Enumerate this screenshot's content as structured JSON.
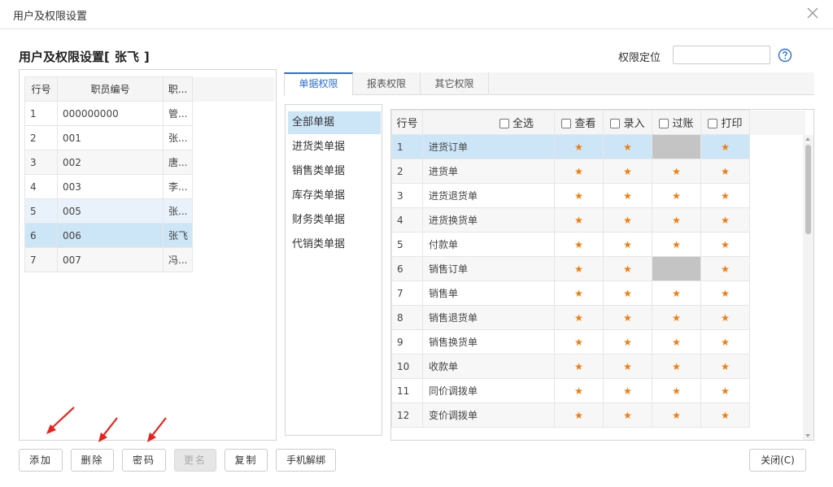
{
  "window": {
    "title": "用户及权限设置"
  },
  "header": {
    "prefix": "用户及权限设置[",
    "user_name": "张飞",
    "suffix": "]"
  },
  "search": {
    "label": "权限定位",
    "value": "",
    "placeholder": ""
  },
  "user_table": {
    "columns": [
      "行号",
      "职员编号",
      "职..."
    ],
    "rows": [
      {
        "idx": "1",
        "code": "000000000",
        "name": "管..."
      },
      {
        "idx": "2",
        "code": "001",
        "name": "张..."
      },
      {
        "idx": "3",
        "code": "002",
        "name": "唐..."
      },
      {
        "idx": "4",
        "code": "003",
        "name": "李..."
      },
      {
        "idx": "5",
        "code": "005",
        "name": "张..."
      },
      {
        "idx": "6",
        "code": "006",
        "name": "张飞"
      },
      {
        "idx": "7",
        "code": "007",
        "name": "冯..."
      }
    ]
  },
  "tabs": [
    {
      "label": "单据权限",
      "active": true
    },
    {
      "label": "报表权限",
      "active": false
    },
    {
      "label": "其它权限",
      "active": false
    }
  ],
  "categories": [
    {
      "label": "全部单据",
      "active": true
    },
    {
      "label": "进货类单据",
      "active": false
    },
    {
      "label": "销售类单据",
      "active": false
    },
    {
      "label": "库存类单据",
      "active": false
    },
    {
      "label": "财务类单据",
      "active": false
    },
    {
      "label": "代销类单据",
      "active": false
    }
  ],
  "perm_table": {
    "columns": {
      "idx": "行号",
      "select_all": "全选",
      "view": "查看",
      "entry": "录入",
      "post": "过账",
      "print": "打印"
    },
    "star": "★",
    "rows": [
      {
        "idx": "1",
        "doc": "进货订单",
        "view": true,
        "entry": true,
        "post": "disabled",
        "print": true
      },
      {
        "idx": "2",
        "doc": "进货单",
        "view": true,
        "entry": true,
        "post": true,
        "print": true
      },
      {
        "idx": "3",
        "doc": "进货退货单",
        "view": true,
        "entry": true,
        "post": true,
        "print": true
      },
      {
        "idx": "4",
        "doc": "进货换货单",
        "view": true,
        "entry": true,
        "post": true,
        "print": true
      },
      {
        "idx": "5",
        "doc": "付款单",
        "view": true,
        "entry": true,
        "post": true,
        "print": true
      },
      {
        "idx": "6",
        "doc": "销售订单",
        "view": true,
        "entry": true,
        "post": "disabled",
        "print": true
      },
      {
        "idx": "7",
        "doc": "销售单",
        "view": true,
        "entry": true,
        "post": true,
        "print": true
      },
      {
        "idx": "8",
        "doc": "销售退货单",
        "view": true,
        "entry": true,
        "post": true,
        "print": true
      },
      {
        "idx": "9",
        "doc": "销售换货单",
        "view": true,
        "entry": true,
        "post": true,
        "print": true
      },
      {
        "idx": "10",
        "doc": "收款单",
        "view": true,
        "entry": true,
        "post": true,
        "print": true
      },
      {
        "idx": "11",
        "doc": "同价调拨单",
        "view": true,
        "entry": true,
        "post": true,
        "print": true
      },
      {
        "idx": "12",
        "doc": "变价调拨单",
        "view": true,
        "entry": true,
        "post": true,
        "print": true
      }
    ]
  },
  "buttons": {
    "add": "添加",
    "delete": "删除",
    "password": "密码",
    "rename": "更名",
    "copy": "复制",
    "unbind": "手机解绑",
    "close": "关闭(C)"
  },
  "colors": {
    "accent": "#2b6fd1",
    "selected": "#cde6f7",
    "star": "#f07c0a",
    "arrow": "#e8221a"
  }
}
